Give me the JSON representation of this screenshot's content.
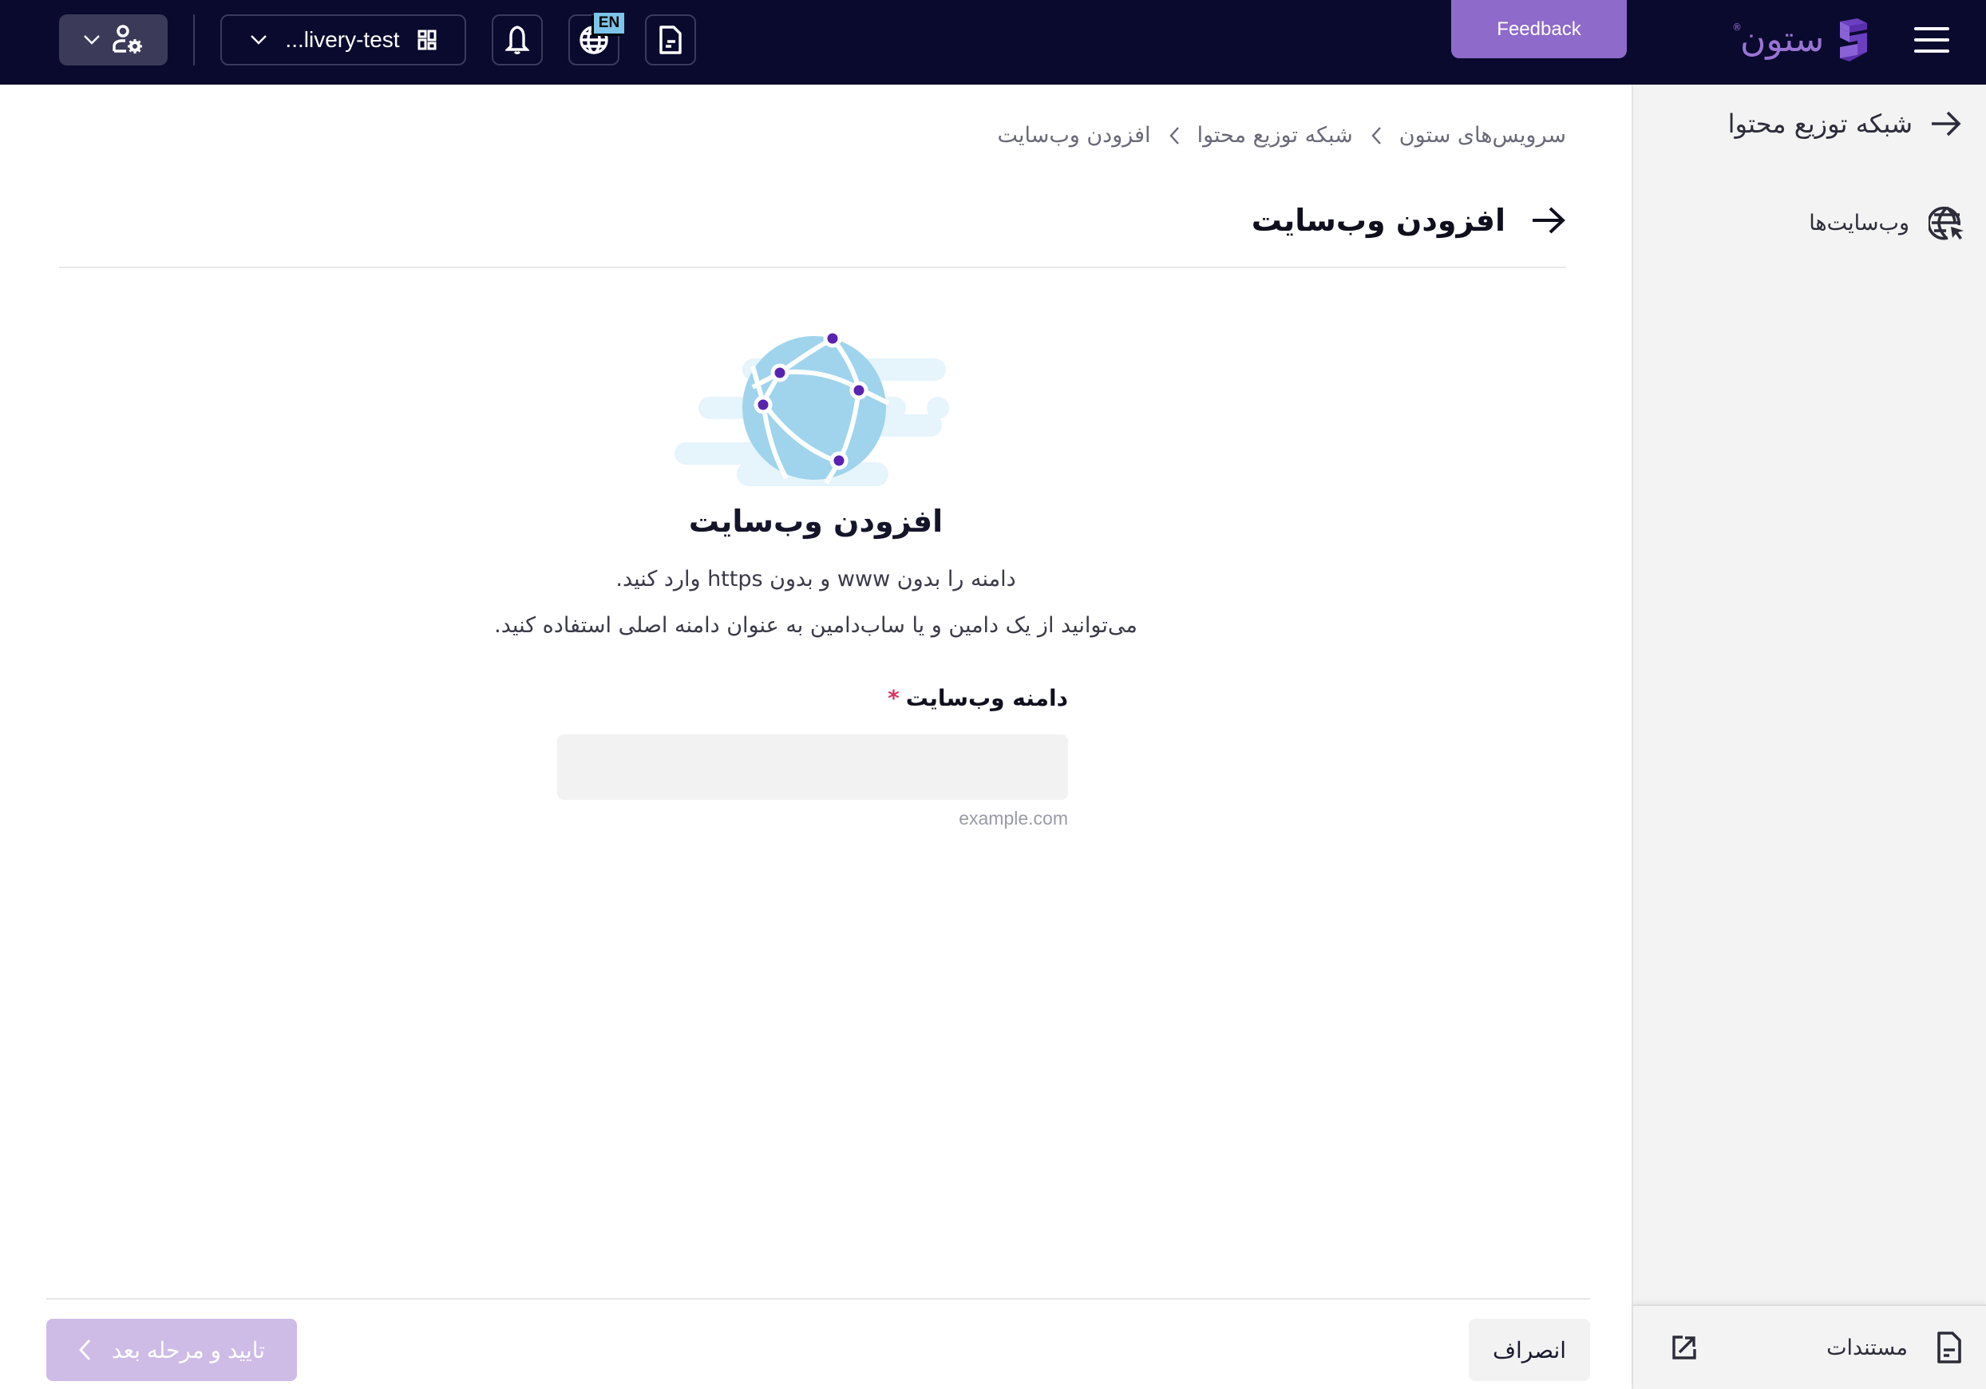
{
  "header": {
    "project_selector": {
      "value": "...livery-test"
    },
    "language_badge": "EN",
    "feedback_label": "Feedback",
    "logo_text": "ستون",
    "logo_mark": "®",
    "icons": {
      "account": "user-settings-icon",
      "project": "dashboard-icon",
      "notifications": "bell-icon",
      "language": "globe-icon",
      "docs": "document-icon",
      "menu": "hamburger-icon"
    }
  },
  "sidebar": {
    "title": "شبکه توزیع محتوا",
    "items": [
      {
        "label": "وب‌سایت‌ها",
        "icon": "globe-cursor-icon"
      }
    ],
    "footer": {
      "label": "مستندات",
      "icon": "document-icon",
      "external_icon": "external-link-icon"
    }
  },
  "breadcrumb": [
    {
      "label": "سرویس‌های ستون"
    },
    {
      "label": "شبکه توزیع محتوا"
    },
    {
      "label": "افزودن وب‌سایت"
    }
  ],
  "page": {
    "title": "افزودن وب‌سایت",
    "hero": {
      "heading": "افزودن وب‌سایت",
      "line1": "دامنه را بدون www و بدون https وارد کنید.",
      "line2": "می‌توانید از یک دامین و یا ساب‌دامین به عنوان دامنه اصلی استفاده کنید."
    },
    "form": {
      "domain_label": "دامنه وب‌سایت",
      "required_mark": "*",
      "domain_value": "",
      "domain_placeholder": "",
      "domain_hint": "example.com"
    },
    "actions": {
      "next_label": "تایید و مرحله بعد",
      "cancel_label": "انصراف"
    }
  },
  "colors": {
    "header_bg": "#0a0a2e",
    "accent": "#8e6acb",
    "accent_disabled": "#cebce6",
    "required": "#d9365e",
    "globe_fill": "#9fd4ec",
    "node": "#5a22b0"
  }
}
